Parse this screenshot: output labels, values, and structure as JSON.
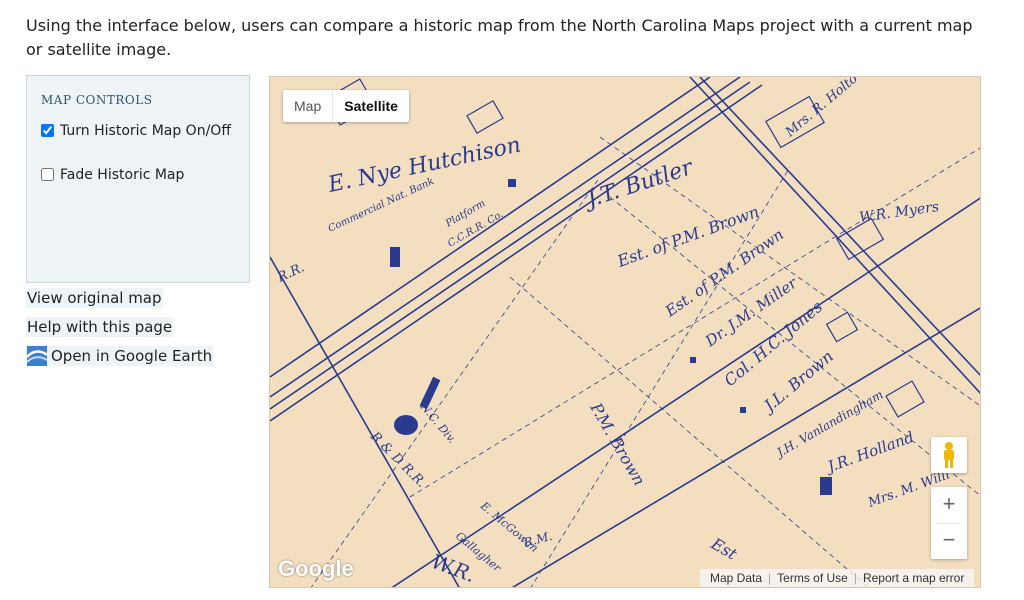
{
  "intro_text": "Using the interface below, users can compare a historic map from the North Carolina Maps project with a current map or satellite image.",
  "controls": {
    "title": "MAP CONTROLS",
    "toggle_label": "Turn Historic Map On/Off",
    "toggle_checked": true,
    "fade_label": "Fade Historic Map",
    "fade_checked": false
  },
  "links": {
    "view_original": "View original map",
    "help": "Help with this page",
    "google_earth": "Open in Google Earth"
  },
  "map": {
    "type_buttons": [
      "Map",
      "Satellite"
    ],
    "selected_type": "Satellite",
    "zoom_in": "+",
    "zoom_out": "−",
    "logo": "Google",
    "attribution": [
      "Map Data",
      "Terms of Use",
      "Report a map error"
    ],
    "labels": [
      "E. Nye Hutchison",
      "J.T. Butler",
      "Est. of P.M. Brown",
      "Est. of P.M. Brown",
      "Dr. J.M. Miller",
      "Col. H.C. Jones",
      "J.L. Brown",
      "J.H. Vanlandingham",
      "J.R. Holland",
      "Mrs. M. Willi",
      "W.R. Myers",
      "P.M. Brown",
      "R & D R.R.",
      "N.C. Div.",
      "R.R.",
      "Mrs. R. Holto",
      "Commercial Nat. Bank",
      "C.C.R.R. Co.",
      "Platform",
      "W.R.",
      "R.M.",
      "E. McGowan",
      "Gallagher",
      "Est"
    ]
  },
  "colors": {
    "map_paper": "#f3dfc0",
    "map_ink": "#2a3b8f",
    "panel_bg": "#eef3f6"
  }
}
